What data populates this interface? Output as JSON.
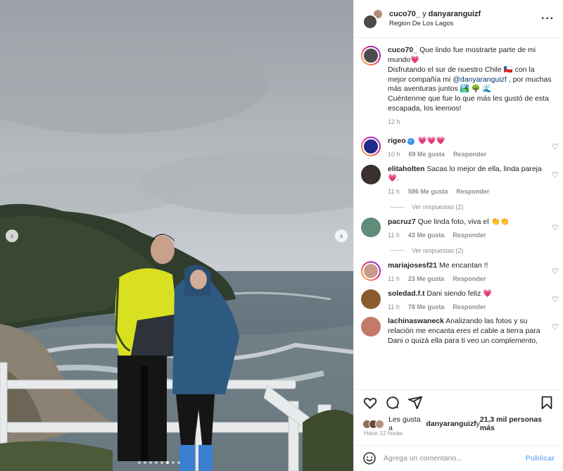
{
  "post": {
    "author": "cuco70_",
    "joiner": " y ",
    "coauthor": "danyaranguizf",
    "location": "Region De Los Lagos",
    "more_icon": "more-options-icon"
  },
  "media": {
    "prev_icon": "chevron-left-icon",
    "next_icon": "chevron-right-icon",
    "prev_glyph": "‹",
    "next_glyph": "›",
    "dots_total": 8,
    "dots_active": 6
  },
  "caption": {
    "user": "cuco70_",
    "line1": " Que lindo fue mostrarte parte de mi mundo💗",
    "line2": "Disfrutando el sur de nuestro Chile 🇨🇱 con la mejor compañía mi ",
    "mention": "@danyaranguizf",
    "line3": " , por muchas más aventuras juntos 🏞️ 🌳 🌊",
    "line4": "Cuéntenme que fue lo que más les gustó de esta escapada, los leemos!",
    "time": "12 h"
  },
  "comments": [
    {
      "user": "rigeo",
      "verified": true,
      "text": " 💗💗💗",
      "time": "10 h",
      "likes": "69 Me gusta",
      "reply": "Responder",
      "color": "#1f2a8a"
    },
    {
      "user": "elitaholten",
      "text": " Sacas lo mejor de ella, linda pareja 💗.",
      "time": "11 h",
      "likes": "586 Me gusta",
      "reply": "Responder",
      "color": "#3b3030",
      "replies": "Ver respuestas (2)"
    },
    {
      "user": "pacruz7",
      "text": " Que linda foto, viva el 👏👏",
      "time": "11 h",
      "likes": "43 Me gusta",
      "reply": "Responder",
      "color": "#5f8d7a",
      "replies": "Ver respuestas (2)"
    },
    {
      "user": "mariajosesf21",
      "text": " Me encantan !!",
      "time": "11 h",
      "likes": "23 Me gusta",
      "reply": "Responder",
      "color": "#c79a8a"
    },
    {
      "user": "soledad.f.t",
      "text": " Dani siendo feliz 💗",
      "time": "11 h",
      "likes": "78 Me gusta",
      "reply": "Responder",
      "color": "#8a5b2e"
    },
    {
      "user": "lachinaswaneck",
      "text": " Analizando las fotos y su relación me encanta eres el cable a tierra para Dani o quizá ella para ti veo un complemento,",
      "color": "#c47a6a"
    }
  ],
  "actions": {
    "like_icon": "heart-icon",
    "comment_icon": "comment-icon",
    "share_icon": "share-icon",
    "save_icon": "bookmark-icon"
  },
  "likes": {
    "prefix": "Les gusta a ",
    "user": "danyaranguizf",
    "suffix": " y ",
    "count": "21,3 mil personas más"
  },
  "posted_ago": "Hace 12 horas",
  "composer": {
    "placeholder": "Agrega un comentario...",
    "publish": "Publicar",
    "emoji_icon": "emoji-icon"
  }
}
